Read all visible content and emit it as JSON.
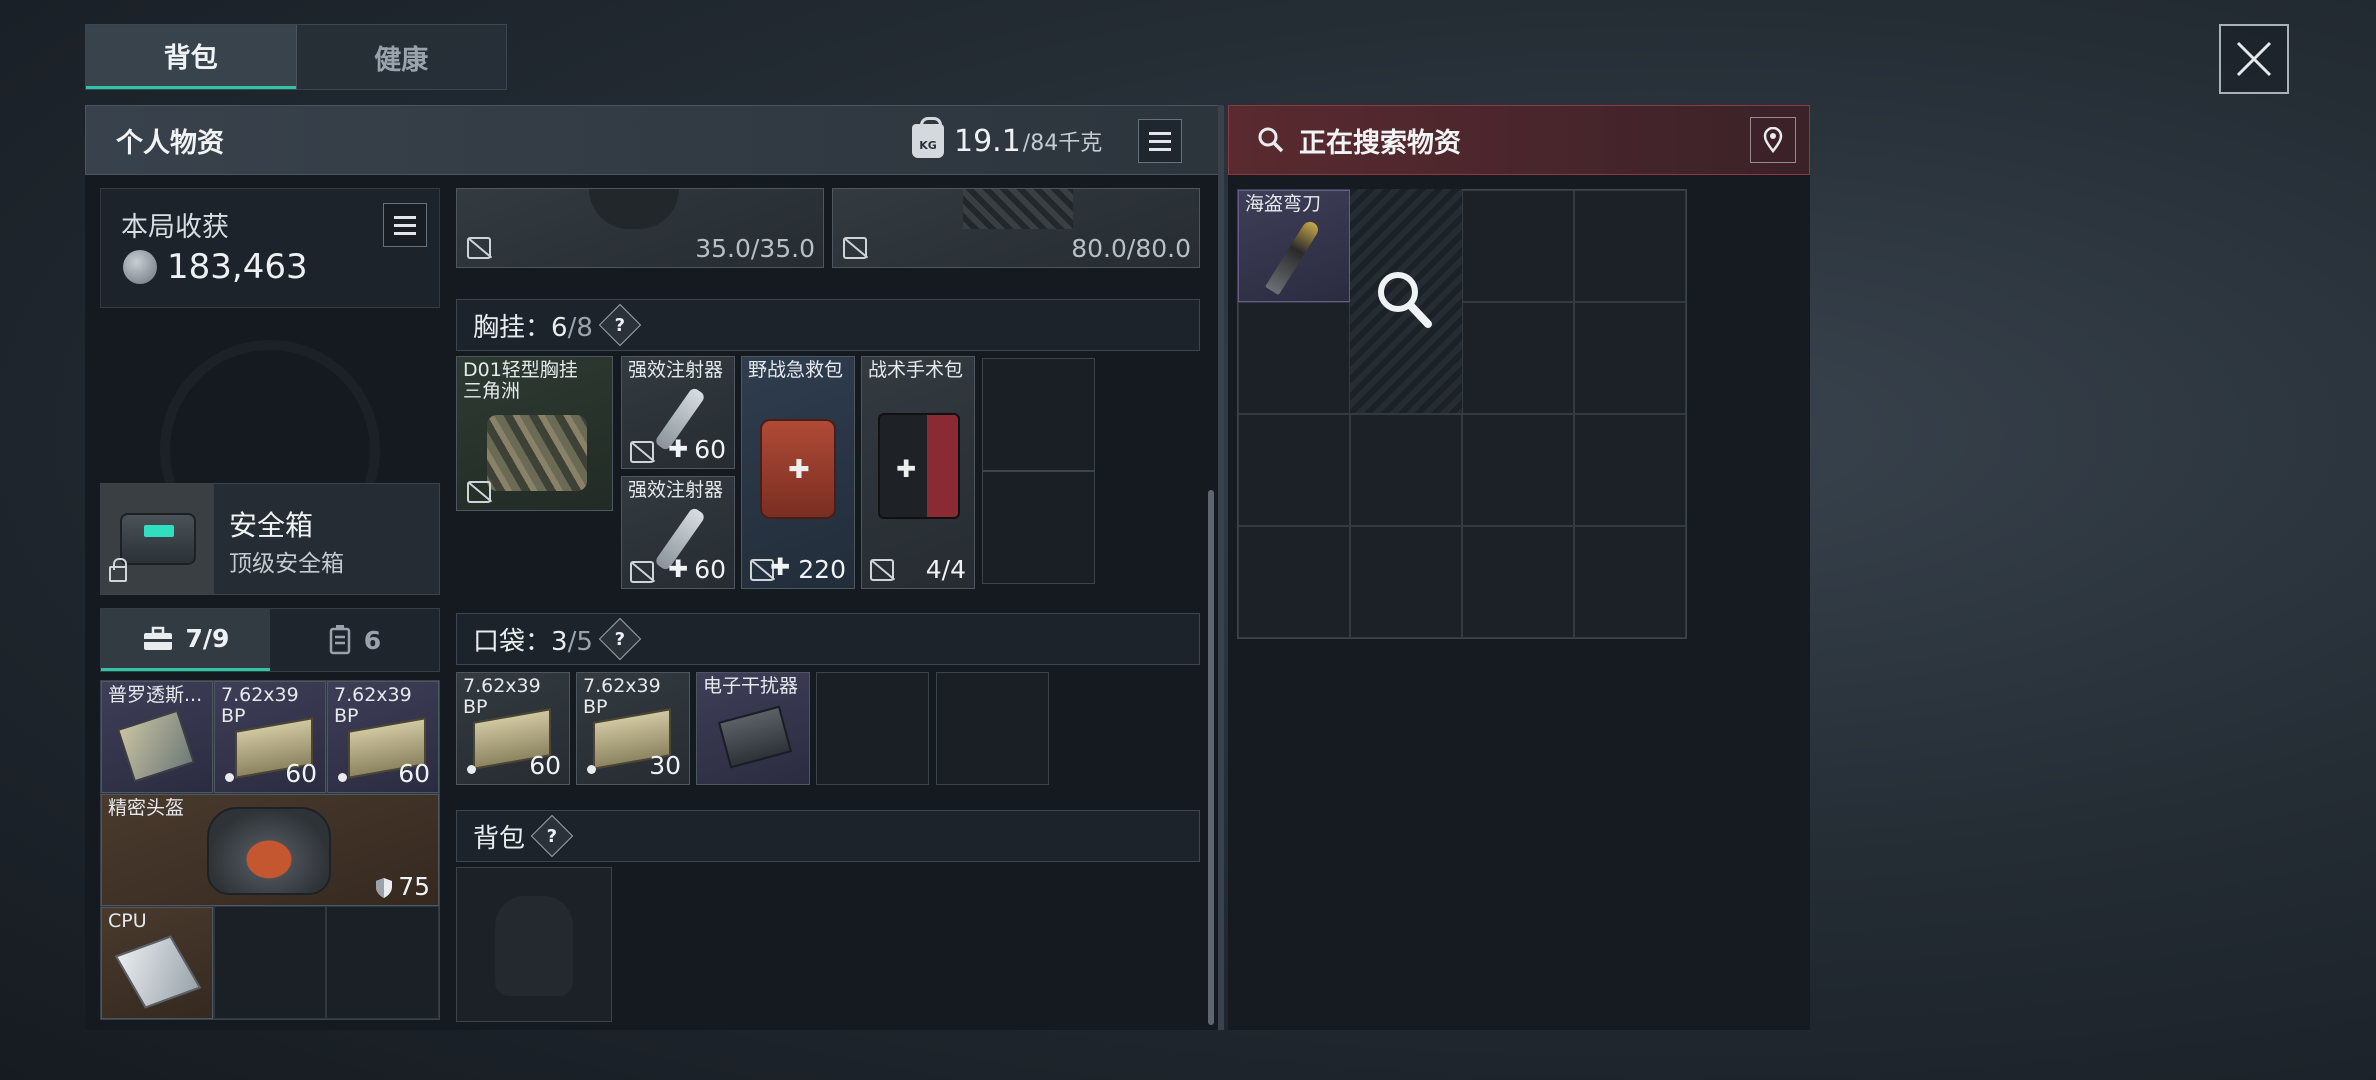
{
  "tabs": {
    "backpack": "背包",
    "health": "健康"
  },
  "personal": {
    "title": "个人物资",
    "weight_current": "19.1",
    "weight_max": "/84千克",
    "kg_badge": "KG"
  },
  "search": {
    "title": "正在搜索物资"
  },
  "haul": {
    "label": "本局收获",
    "value": "183,463"
  },
  "safe": {
    "title": "安全箱",
    "subtitle": "顶级安全箱"
  },
  "bag_tabs": {
    "tools_count": "7/9",
    "ammo_count": "6"
  },
  "left_items": {
    "item1_name": "普罗透斯...",
    "item2_name": "7.62x39 BP",
    "item2_qty": "60",
    "item3_name": "7.62x39 BP",
    "item3_qty": "60",
    "helmet_name": "精密头盔",
    "helmet_durability": "75",
    "cpu_name": "CPU"
  },
  "top_items": {
    "durability1": "35.0/35.0",
    "durability2": "80.0/80.0"
  },
  "chest_rig": {
    "label": "胸挂",
    "capacity_used": "6",
    "capacity_total": "/8",
    "rig_name": "D01轻型胸挂 三角洲",
    "injector1_name": "强效注射器",
    "injector1_qty": "60",
    "injector2_name": "强效注射器",
    "injector2_qty": "60",
    "firstaid_name": "野战急救包",
    "firstaid_qty": "220",
    "surgery_name": "战术手术包",
    "surgery_qty": "4/4"
  },
  "pockets": {
    "label": "口袋",
    "capacity_used": "3",
    "capacity_total": "/5",
    "ammo1_name": "7.62x39 BP",
    "ammo1_qty": "60",
    "ammo2_name": "7.62x39 BP",
    "ammo2_qty": "30",
    "jammer_name": "电子干扰器"
  },
  "backpack_section": {
    "label": "背包"
  },
  "search_items": {
    "knife_name": "海盗弯刀"
  },
  "colors": {
    "accent": "#2fc4a6",
    "search_header": "#5a2a30"
  },
  "icons": [
    "close-icon",
    "list-icon",
    "search-icon",
    "pin-icon",
    "lock-icon",
    "coin-icon",
    "toolbox-icon",
    "ammo-icon",
    "question-icon",
    "no-sell-icon",
    "plus-icon",
    "shield-icon",
    "kg-weight-icon"
  ]
}
